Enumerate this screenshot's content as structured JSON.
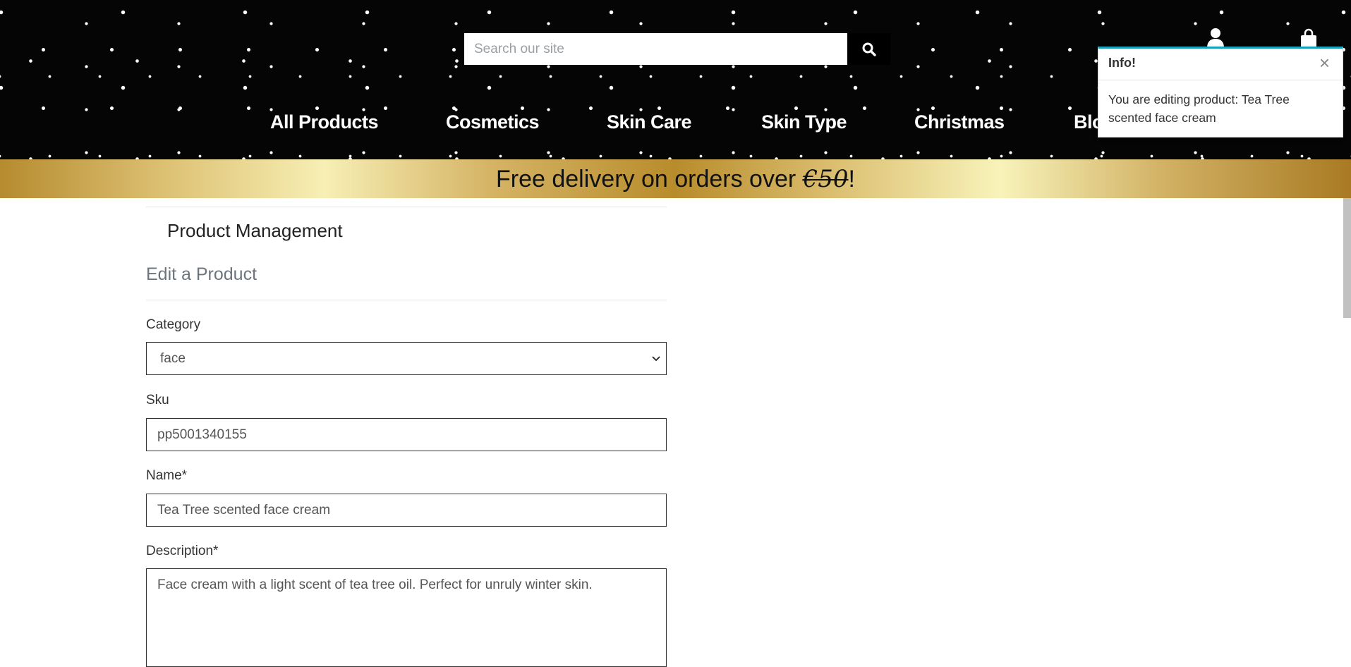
{
  "header": {
    "search_placeholder": "Search our site",
    "nav": [
      {
        "label": "All Products"
      },
      {
        "label": "Cosmetics"
      },
      {
        "label": "Skin Care"
      },
      {
        "label": "Skin Type"
      },
      {
        "label": "Christmas"
      },
      {
        "label": "Blog"
      }
    ]
  },
  "promo": {
    "text_before": "Free delivery on orders over ",
    "amount": "€50",
    "text_after": "!"
  },
  "toast": {
    "title": "Info!",
    "close_glyph": "×",
    "message": "You are editing product: Tea Tree scented face cream",
    "accent_color": "#17a2b8"
  },
  "page": {
    "title": "Product Management",
    "subtitle": "Edit a Product"
  },
  "form": {
    "category_label": "Category",
    "category_value": "face",
    "sku_label": "Sku",
    "sku_value": "pp5001340155",
    "name_label": "Name*",
    "name_value": "Tea Tree scented face cream",
    "description_label": "Description*",
    "description_value": "Face cream with a light scent of tea tree oil. Perfect for unruly winter skin."
  }
}
